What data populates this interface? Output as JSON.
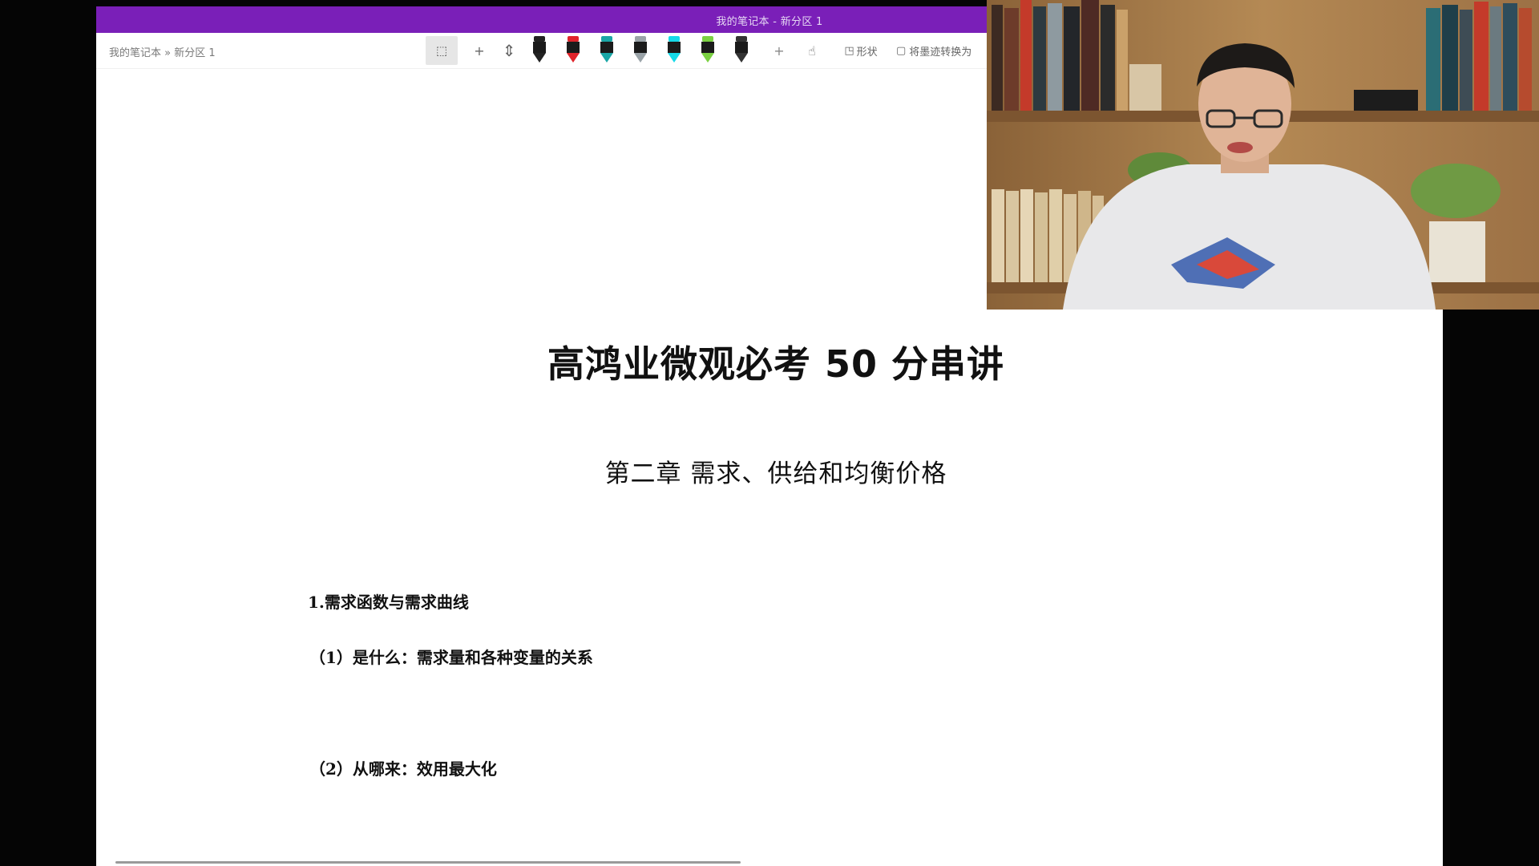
{
  "window": {
    "title": "我的笔记本 - 新分区 1",
    "breadcrumb": "我的笔记本 » 新分区 1",
    "accent_color": "#7a1fb8"
  },
  "toolbar": {
    "lasso_icon": "lasso-select-icon",
    "add_space_label": "+",
    "eraser_icon": "add-space-icon",
    "pens": [
      {
        "name": "pen-black",
        "color": "#222222"
      },
      {
        "name": "pen-red",
        "color": "#e0242b"
      },
      {
        "name": "pen-teal",
        "color": "#1aa6a6"
      },
      {
        "name": "pen-gray",
        "color": "#9aa3a8"
      },
      {
        "name": "highlighter-cyan",
        "color": "#16d9e8"
      },
      {
        "name": "highlighter-green",
        "color": "#7bd142"
      },
      {
        "name": "pen-dark",
        "color": "#333333"
      }
    ],
    "add_pen_label": "+",
    "shapes_label": "形状",
    "convert_label": "将墨迹转换为"
  },
  "document": {
    "title": "高鸿业微观必考 50 分串讲",
    "chapter": "第二章  需求、供给和均衡价格",
    "section_heading": "1.需求函数与需求曲线",
    "items": [
      "（1）是什么：需求量和各种变量的关系",
      "（2）从哪来：效用最大化"
    ]
  },
  "webcam": {
    "description_icon": "webcam-video-icon"
  }
}
